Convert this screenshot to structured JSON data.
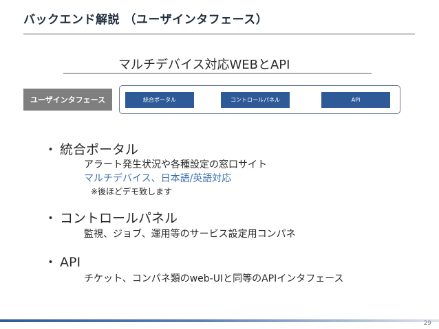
{
  "slide": {
    "title": "バックエンド解説 （ユーザインタフェース）",
    "subtitle": "マルチデバイス対応WEBとAPI",
    "page_number": "29"
  },
  "diagram": {
    "label": "ユーザインタフェース",
    "boxes": [
      "統合ポータル",
      "コントロールパネル",
      "API"
    ],
    "box_color": "#2e5a97",
    "label_color": "#7f7f7f"
  },
  "bullets": [
    {
      "marker": "・",
      "heading": "統合ポータル",
      "details": [
        "アラート発生状況や各種設定の窓口サイト",
        "マルチデバイス、日本語/英語対応"
      ],
      "note": "※後ほどデモ致します"
    },
    {
      "marker": "・",
      "heading": "コントロールパネル",
      "details": [
        "監視、ジョブ、運用等のサービス設定用コンパネ"
      ]
    },
    {
      "marker": "・",
      "heading": "API",
      "details": [
        "チケット、コンパネ類のweb-UIと同等のAPIインタフェース"
      ]
    }
  ],
  "colors": {
    "highlight_text": "#3e6fae"
  }
}
